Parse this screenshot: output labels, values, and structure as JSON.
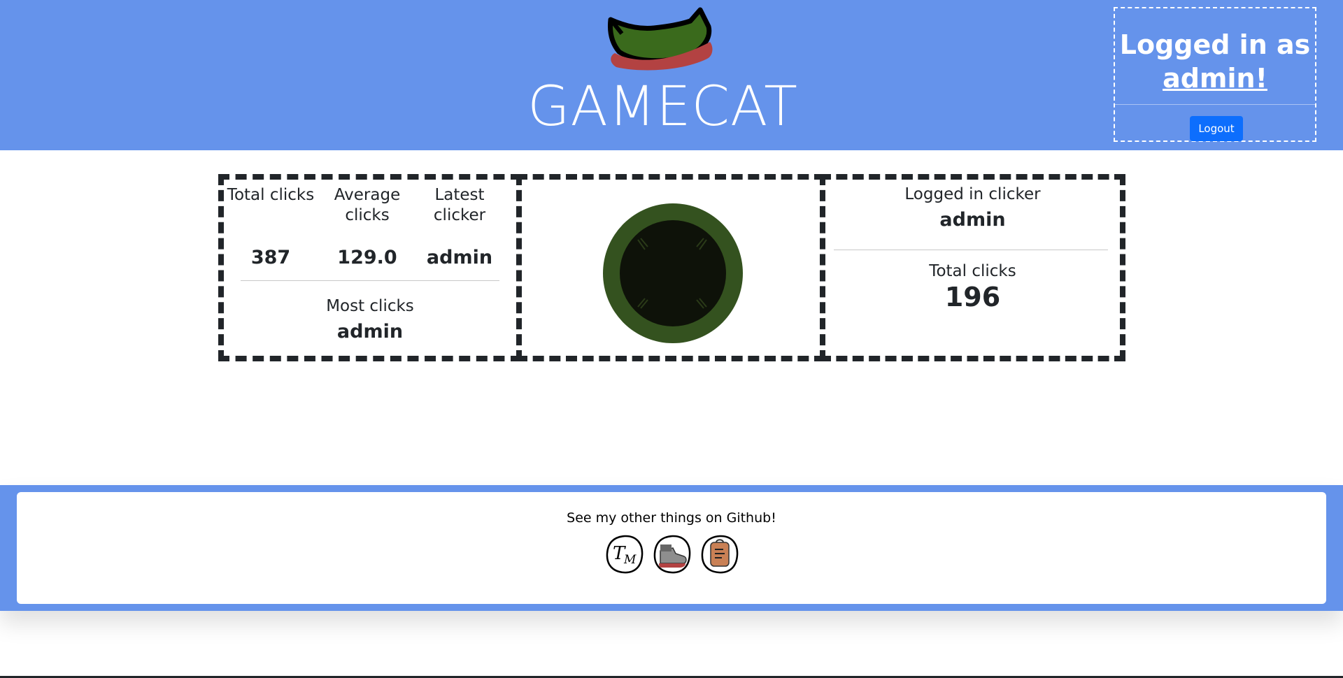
{
  "header": {
    "site_title": "GAMECAT",
    "login_prefix": "Logged in as",
    "login_user": "admin!",
    "logout_label": "Logout"
  },
  "stats": {
    "total_clicks_label": "Total clicks",
    "total_clicks_value": "387",
    "average_clicks_label": "Average clicks",
    "average_clicks_value": "129.0",
    "latest_clicker_label": "Latest clicker",
    "latest_clicker_value": "admin",
    "most_clicks_label": "Most clicks",
    "most_clicks_value": "admin"
  },
  "user_panel": {
    "logged_in_clicker_label": "Logged in clicker",
    "logged_in_clicker_value": "admin",
    "total_clicks_label": "Total clicks",
    "total_clicks_value": "196"
  },
  "footer": {
    "text": "See my other things on Github!",
    "icons": [
      "tm-icon",
      "shoe-icon",
      "backpack-icon"
    ]
  },
  "colors": {
    "header_bg": "#6593eb",
    "button_bg": "#0d6efd",
    "dark": "#212529",
    "cat_green": "#3a5420",
    "scarf_red": "#b34242"
  }
}
